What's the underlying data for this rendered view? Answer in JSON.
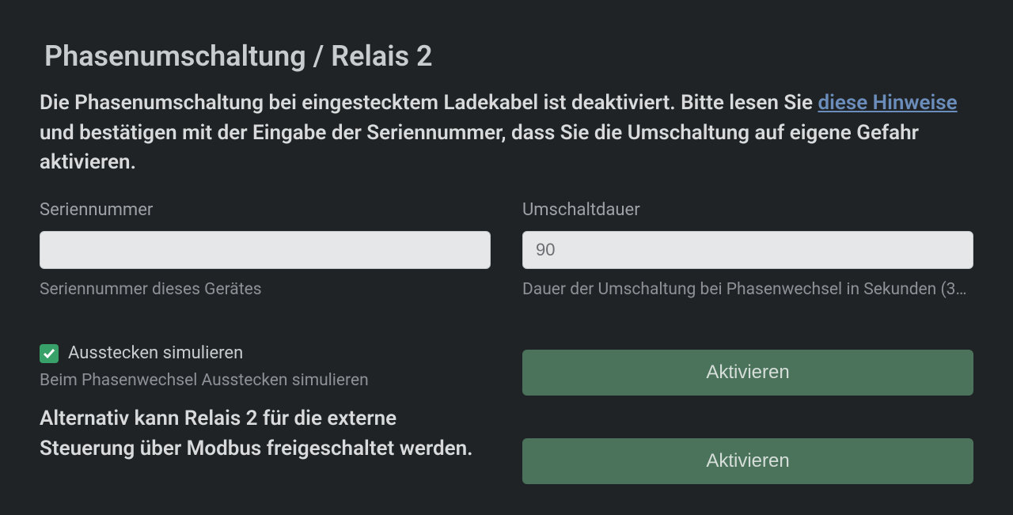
{
  "page": {
    "title": "Phasenumschaltung / Relais 2"
  },
  "description": {
    "text_before": "Die Phasenumschaltung bei eingestecktem Ladekabel ist deaktiviert. Bitte lesen Sie ",
    "link_text": "diese Hinweise",
    "text_after": " und bestätigen mit der Eingabe der Seriennummer, dass Sie die Umschaltung auf eigene Gefahr aktivieren."
  },
  "serial": {
    "label": "Seriennummer",
    "value": "",
    "help": "Seriennummer dieses Gerätes"
  },
  "duration": {
    "label": "Umschaltdauer",
    "value": "90",
    "help": "Dauer der Umschaltung bei Phasenwechsel in Sekunden (3…"
  },
  "simulate": {
    "label": "Ausstecken simulieren",
    "checked": true,
    "help": "Beim Phasenwechsel Ausstecken simulieren"
  },
  "alt_text": "Alternativ kann Relais 2 für die externe Steuerung über Modbus freigeschaltet werden.",
  "buttons": {
    "activate1": "Aktivieren",
    "activate2": "Aktivieren"
  }
}
